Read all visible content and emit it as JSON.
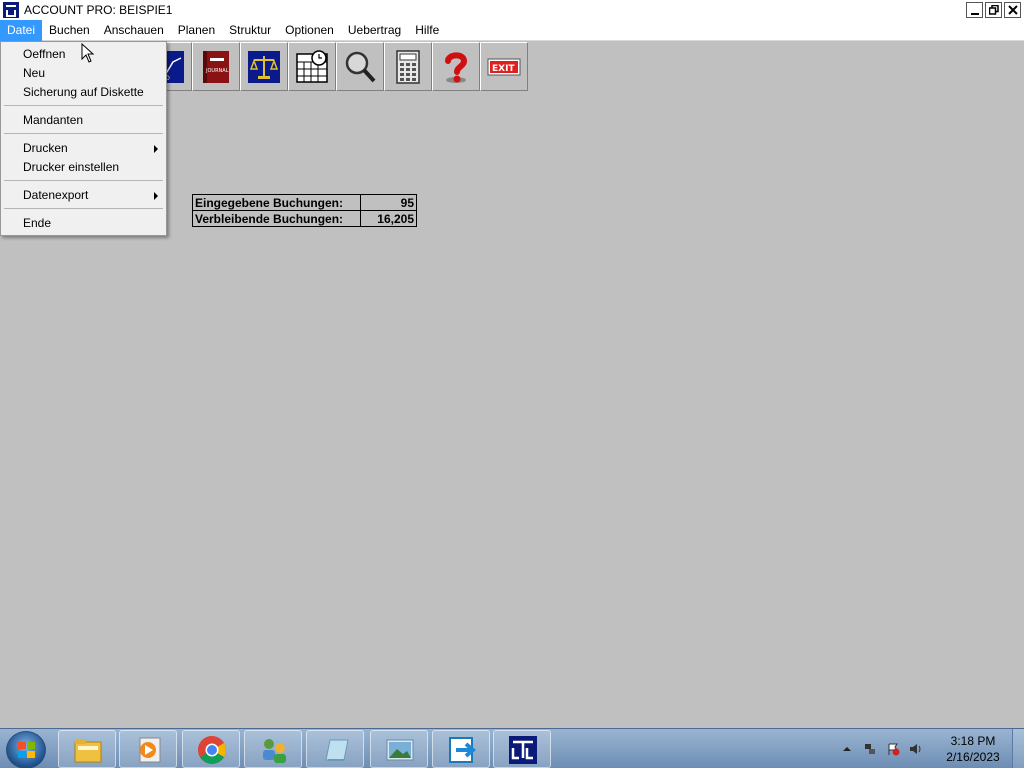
{
  "window": {
    "title": "ACCOUNT PRO: BEISPIE1",
    "controls": [
      "minimize",
      "restore",
      "close"
    ]
  },
  "menubar": {
    "items": [
      {
        "label": "Datei",
        "active": true
      },
      {
        "label": "Buchen"
      },
      {
        "label": "Anschauen"
      },
      {
        "label": "Planen"
      },
      {
        "label": "Struktur"
      },
      {
        "label": "Optionen"
      },
      {
        "label": "Uebertrag"
      },
      {
        "label": "Hilfe"
      }
    ]
  },
  "dropdown": {
    "items": [
      {
        "label": "Oeffnen"
      },
      {
        "label": "Neu"
      },
      {
        "label": "Sicherung auf Diskette"
      },
      {
        "label": "Mandanten"
      },
      {
        "label": "Drucken",
        "submenu": true
      },
      {
        "label": "Drucker einstellen"
      },
      {
        "label": "Datenexport",
        "submenu": true
      },
      {
        "label": "Ende"
      }
    ]
  },
  "toolbar": {
    "buttons": [
      {
        "icon": "konto-chart-icon",
        "label": "NTO"
      },
      {
        "icon": "journal-book-icon",
        "label": "JOURNAL"
      },
      {
        "icon": "balance-scale-icon"
      },
      {
        "icon": "calendar-clock-icon"
      },
      {
        "icon": "magnifier-icon"
      },
      {
        "icon": "calculator-icon"
      },
      {
        "icon": "help-question-icon"
      },
      {
        "icon": "exit-sign-icon",
        "label": "EXIT"
      }
    ]
  },
  "stats": {
    "entered_label": "Eingegebene Buchungen:",
    "entered_value": "95",
    "remaining_label": "Verbleibende Buchungen:",
    "remaining_value": "16,205"
  },
  "taskbar": {
    "apps": [
      "file-explorer-icon",
      "media-player-icon",
      "chrome-icon",
      "network-users-icon",
      "notepad-icon",
      "photo-viewer-icon",
      "remote-transfer-icon",
      "account-pro-icon"
    ],
    "clock_time": "3:18 PM",
    "clock_date": "2/16/2023"
  },
  "colors": {
    "menu_highlight": "#3399ff",
    "workspace": "#c0c0c0",
    "taskbar": "#7a9cc4"
  }
}
